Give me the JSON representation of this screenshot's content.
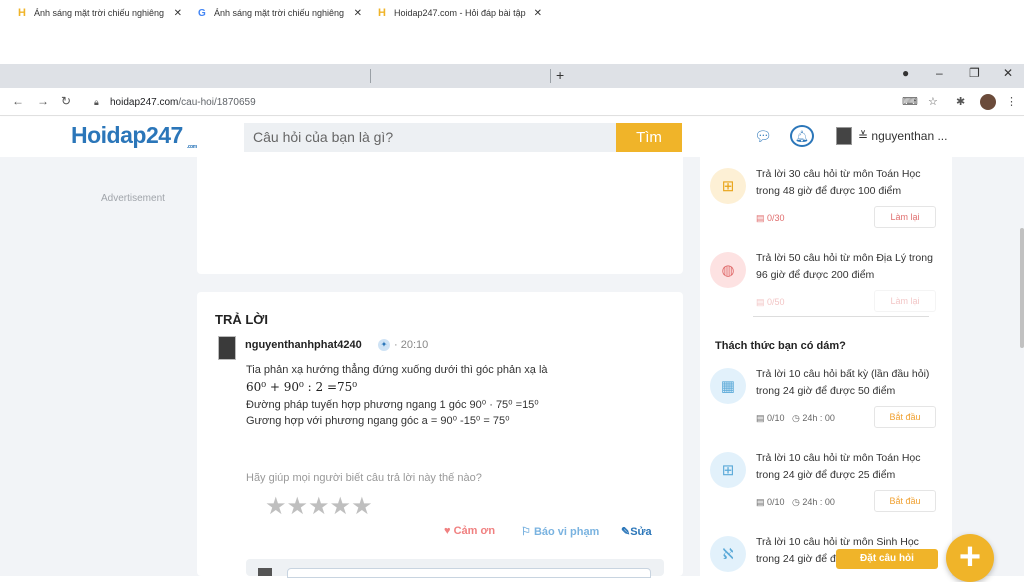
{
  "browser": {
    "tabs": [
      {
        "title": "Ánh sáng mặt trời chiếu nghiêng",
        "favicon": "hoidap-h-icon"
      },
      {
        "title": "Ánh sáng mặt trời chiếu nghiêng",
        "favicon": "google-g-icon"
      },
      {
        "title": "Hoidap247.com - Hỏi đáp bài tập",
        "favicon": "hoidap-h-icon"
      }
    ],
    "url_host": "hoidap247.com",
    "url_path": "/cau-hoi/1870659"
  },
  "header": {
    "logo": "Hoidap247",
    "logo_suffix": ".com",
    "search_placeholder": "Câu hỏi của bạn là gì?",
    "search_button": "Tìm",
    "username": "nguyenthan ..."
  },
  "main": {
    "ad_label": "Advertisement",
    "answer": {
      "section_title": "TRẢ LỜI",
      "author": "nguyenthanhphat4240",
      "time": "· 20:10",
      "lines": [
        "Tia phản xạ hướng thẳng đứng xuống dưới thì góc phản xạ là",
        "60⁰ + 90⁰ : 2 =75⁰",
        "Đường pháp tuyến hợp phương ngang 1 góc 90⁰ · 75⁰ =15⁰",
        "Gương hợp với phương ngang góc a = 90⁰ -15⁰ = 75⁰"
      ],
      "help_text": "Hãy giúp mọi người biết câu trả lời này thế nào?",
      "rating_stars": 5,
      "thanks": "Cảm ơn",
      "report": "Báo vi phạm",
      "edit": "Sửa"
    }
  },
  "sidebar": {
    "tasks_top": [
      {
        "text": "Trả lời 30 câu hỏi  từ môn Toán Học trong 48 giờ để được 100 điểm",
        "progress": "0/30",
        "button": "Làm lại",
        "icon": "math-icon"
      },
      {
        "text": "Trả lời 50 câu hỏi  từ môn Địa Lý trong 96 giờ để được 200 điểm",
        "progress": "0/50",
        "button": "Làm lại",
        "icon": "globe-icon"
      }
    ],
    "challenge_title": "Thách thức bạn có dám?",
    "challenges": [
      {
        "text": "Trả lời 10 câu hỏi  bất kỳ (lần đầu hỏi) trong 24 giờ để được 50 điểm",
        "progress": "0/10",
        "timer": "24h : 00",
        "button": "Bắt đầu",
        "icon": "grid-icon"
      },
      {
        "text": "Trả lời 10 câu hỏi  từ môn Toán Học trong 24 giờ để được 25 điểm",
        "progress": "0/10",
        "timer": "24h : 00",
        "button": "Bắt đầu",
        "icon": "math-icon"
      },
      {
        "text": "Trả lời 10 câu hỏi  từ môn Sinh Học trong 24 giờ để được",
        "icon": "dna-icon"
      }
    ]
  },
  "floating": {
    "ask_label": "Đặt câu hỏi"
  }
}
